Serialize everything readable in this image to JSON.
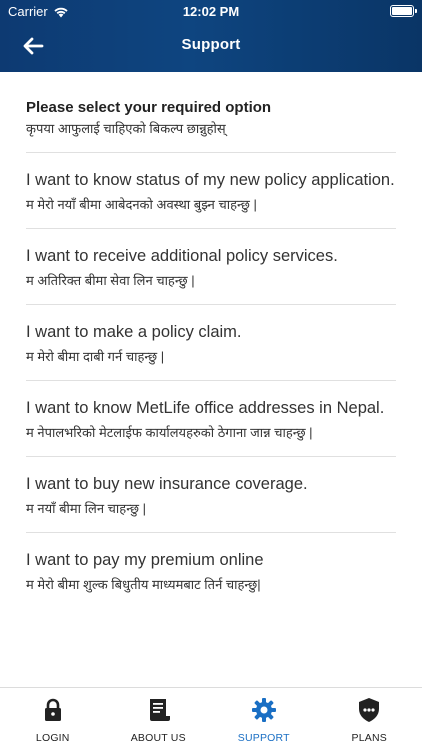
{
  "status_bar": {
    "carrier": "Carrier",
    "time": "12:02 PM"
  },
  "header": {
    "title": "Support",
    "back_icon": "arrow-left-icon"
  },
  "intro": {
    "title": "Please select your required option",
    "subtitle": "कृपया आफुलाई चाहिएको बिकल्प छान्नुहोस्"
  },
  "options": [
    {
      "en": "I want to know status of my new policy application.",
      "ne": "म मेरो नयाँ बीमा आबेदनको अवस्था बुझ्न चाहन्छु |"
    },
    {
      "en": "I want to receive additional policy services.",
      "ne": "म अतिरिक्त बीमा सेवा लिन चाहन्छु |"
    },
    {
      "en": "I want to make a policy claim.",
      "ne": "म मेरो बीमा दाबी गर्न चाहन्छु |"
    },
    {
      "en": "I want to know MetLife office addresses in Nepal.",
      "ne": "म नेपालभरिको मेटलाईफ कार्यालयहरुको ठेगाना जान्न चाहन्छु |"
    },
    {
      "en": "I want to buy new insurance coverage.",
      "ne": "म नयाँ बीमा लिन चाहन्छु |"
    },
    {
      "en": "I want to pay my premium online",
      "ne": "म मेरो बीमा शुल्क बिधुतीय माध्यमबाट तिर्न चाहन्छु|"
    }
  ],
  "tabs": [
    {
      "label": "LOGIN",
      "icon": "lock-icon"
    },
    {
      "label": "ABOUT US",
      "icon": "document-icon"
    },
    {
      "label": "SUPPORT",
      "icon": "gear-icon"
    },
    {
      "label": "PLANS",
      "icon": "shield-dots-icon"
    }
  ],
  "colors": {
    "header_bg": "#0e4580",
    "active_tab": "#1a6fc4",
    "divider": "#e0e0e0"
  }
}
